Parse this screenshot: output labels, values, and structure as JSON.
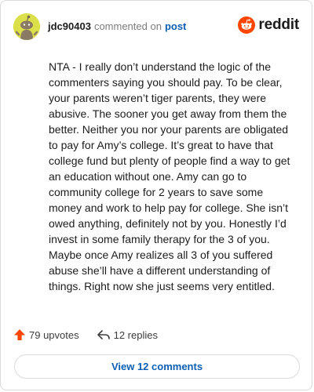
{
  "header": {
    "username": "jdc90403",
    "action_text": "commented on",
    "post_link": "post",
    "avatar_color": "#dbe04a"
  },
  "brand": {
    "wordmark": "reddit",
    "logo_color": "#ff4500"
  },
  "comment": {
    "text": "NTA - I really don’t understand the logic of the commenters saying you should pay. To be clear, your parents weren’t tiger parents, they were abusive. The sooner you get away from them the better. Neither you nor your parents are obligated to pay for Amy’s college. It’s great to have that college fund but plenty of people find a way to get an education without one. Amy can go to community college for 2 years to save some money and work to help pay for college. She isn’t owed anything, definitely not by you. Honestly I’d invest in some family therapy for the 3 of you. Maybe once Amy realizes all 3 of you suffered abuse she’ll have a different understanding of things. Right now she just seems very entitled."
  },
  "actions": {
    "upvotes_label": "79 upvotes",
    "upvote_icon": "upvote-arrow-icon",
    "upvote_color": "#ff4500",
    "replies_label": "12 replies",
    "reply_icon": "reply-arrow-icon"
  },
  "footer": {
    "view_comments_label": "View 12 comments",
    "link_color": "#0b5fb3"
  }
}
